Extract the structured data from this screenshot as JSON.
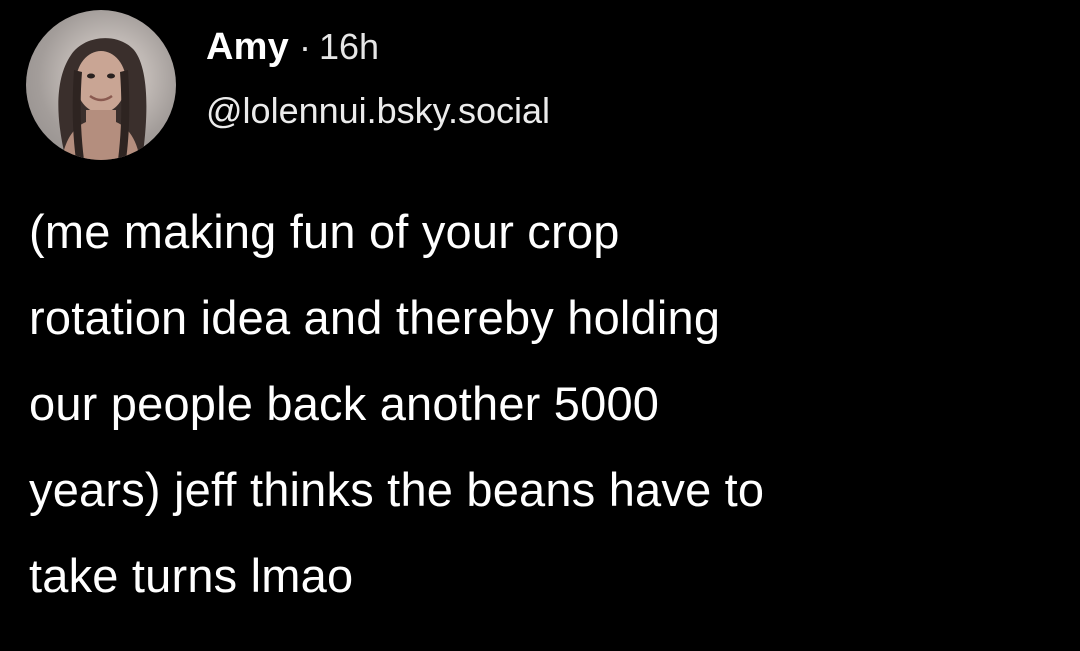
{
  "post": {
    "author": {
      "display_name": "Amy",
      "separator": "·",
      "time_ago": "16h",
      "handle": "@lolennui.bsky.social",
      "avatar_icon": "profile-photo-avatar"
    },
    "text": "(me making fun of your crop\nrotation idea and thereby holding\nour people back another 5000\nyears) jeff thinks the beans have to\ntake turns lmao"
  },
  "colors": {
    "background": "#000000",
    "text": "#ffffff",
    "secondary_text": "#e6e6e6"
  }
}
